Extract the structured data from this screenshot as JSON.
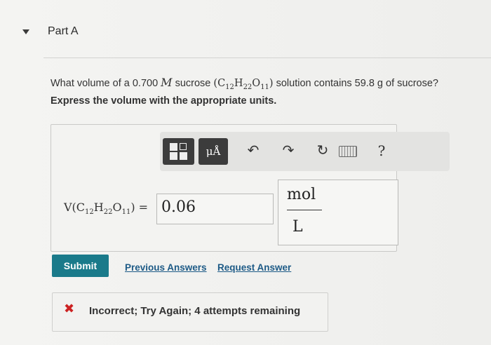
{
  "part": {
    "title": "Part A"
  },
  "question": {
    "text_before": "What volume of a 0.700 ",
    "molarity_symbol": "M",
    "text_sucrose": " sucrose ",
    "formula_open": "(C",
    "c_sub": "12",
    "h": "H",
    "h_sub": "22",
    "o": "O",
    "o_sub": "11",
    "formula_close": ")",
    "text_after": " solution contains 59.8 g of sucrose?",
    "instruction": "Express the volume with the appropriate units."
  },
  "toolbar": {
    "templates_icon": "templates-icon",
    "units_label": "μÅ",
    "undo": "↶",
    "redo": "↷",
    "reset": "↻",
    "keyboard_icon": "keyboard-icon",
    "help": "?"
  },
  "answer": {
    "var_prefix": "V(C",
    "c_sub": "12",
    "h": "H",
    "h_sub": "22",
    "o": "O",
    "o_sub": "11",
    "var_suffix": ") =",
    "value": "0.06",
    "unit_numerator": "mol",
    "unit_denominator": "L"
  },
  "actions": {
    "submit": "Submit",
    "previous_answers": "Previous Answers",
    "request_answer": "Request Answer"
  },
  "feedback": {
    "icon": "✖",
    "text": "Incorrect; Try Again; 4 attempts remaining",
    "color": "#cc2222"
  },
  "colors": {
    "submit_bg": "#1a7a8a",
    "link": "#1d5a86"
  }
}
